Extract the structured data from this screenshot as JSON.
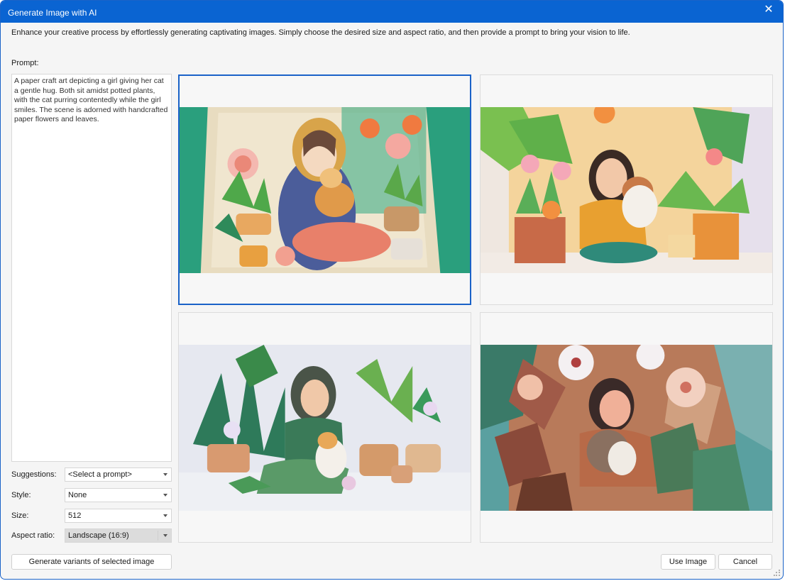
{
  "window": {
    "title": "Generate Image with AI",
    "close_glyph": "✕",
    "description": "Enhance your creative process by effortlessly generating captivating images. Simply choose the desired size and aspect ratio, and then provide a prompt to bring your vision to life."
  },
  "prompt": {
    "label": "Prompt:",
    "value": "A paper craft art depicting a girl giving her cat a gentle hug. Both sit amidst potted plants, with the cat purring contentedly while the girl smiles. The scene is adorned with handcrafted paper flowers and leaves."
  },
  "options": {
    "suggestions": {
      "label": "Suggestions:",
      "value": "<Select a prompt>"
    },
    "style": {
      "label": "Style:",
      "value": "None"
    },
    "size": {
      "label": "Size:",
      "value": "512"
    },
    "aspect_ratio": {
      "label": "Aspect ratio:",
      "value": "Landscape (16:9)"
    }
  },
  "buttons": {
    "generate_variants": "Generate variants of selected image",
    "use_image": "Use Image",
    "cancel": "Cancel"
  },
  "images": [
    {
      "selected": true
    },
    {
      "selected": false
    },
    {
      "selected": false
    },
    {
      "selected": false
    }
  ],
  "colors": {
    "accent": "#1a62c8",
    "titlebar": "#0a64d2"
  }
}
